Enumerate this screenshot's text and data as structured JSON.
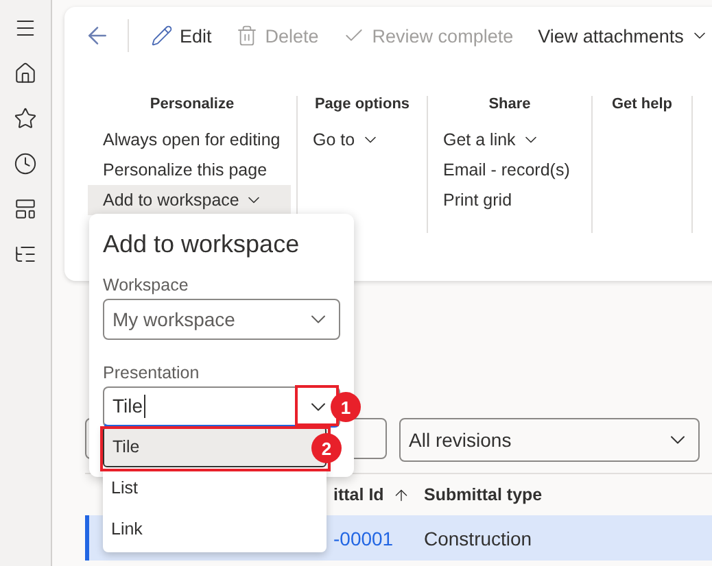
{
  "toolbar": {
    "buttons": [
      {
        "kind": "edit",
        "label": "Edit",
        "disabled": false,
        "dropdown": false
      },
      {
        "kind": "delete",
        "label": "Delete",
        "disabled": true,
        "dropdown": false
      },
      {
        "kind": "check",
        "label": "Review complete",
        "disabled": true,
        "dropdown": false
      },
      {
        "kind": "plain",
        "label": "View attachments",
        "disabled": false,
        "dropdown": true
      }
    ]
  },
  "ribbon_groups": [
    {
      "header": "Personalize",
      "items": [
        {
          "label": "Always open for editing",
          "selected": false,
          "dropdown": false
        },
        {
          "label": "Personalize this page",
          "selected": false,
          "dropdown": false
        },
        {
          "label": "Add to workspace",
          "selected": true,
          "dropdown": true
        }
      ]
    },
    {
      "header": "Page options",
      "items": [
        {
          "label": "Go to",
          "selected": false,
          "dropdown": true
        }
      ]
    },
    {
      "header": "Share",
      "items": [
        {
          "label": "Get a link",
          "selected": false,
          "dropdown": true
        },
        {
          "label": "Email - record(s)",
          "selected": false,
          "dropdown": false
        },
        {
          "label": "Print grid",
          "selected": false,
          "dropdown": false
        }
      ]
    },
    {
      "header": "Get help"
    }
  ],
  "filters": {
    "revision": "All revisions"
  },
  "grid": {
    "columns": [
      {
        "label": "ittal Id",
        "sorted": true
      },
      {
        "label": "Submittal type",
        "sorted": false
      }
    ],
    "rows": [
      {
        "cells": [
          "-00001",
          "Construction"
        ],
        "selected": true
      }
    ]
  },
  "dialog": {
    "title": "Add to workspace",
    "workspace": {
      "label": "Workspace",
      "value": "My workspace"
    },
    "presentation": {
      "label": "Presentation",
      "value": "Tile",
      "options": [
        {
          "label": "Tile",
          "selected": true
        },
        {
          "label": "List",
          "selected": false
        },
        {
          "label": "Link",
          "selected": false
        }
      ]
    }
  },
  "callouts": [
    {
      "number": "1"
    },
    {
      "number": "2"
    }
  ]
}
